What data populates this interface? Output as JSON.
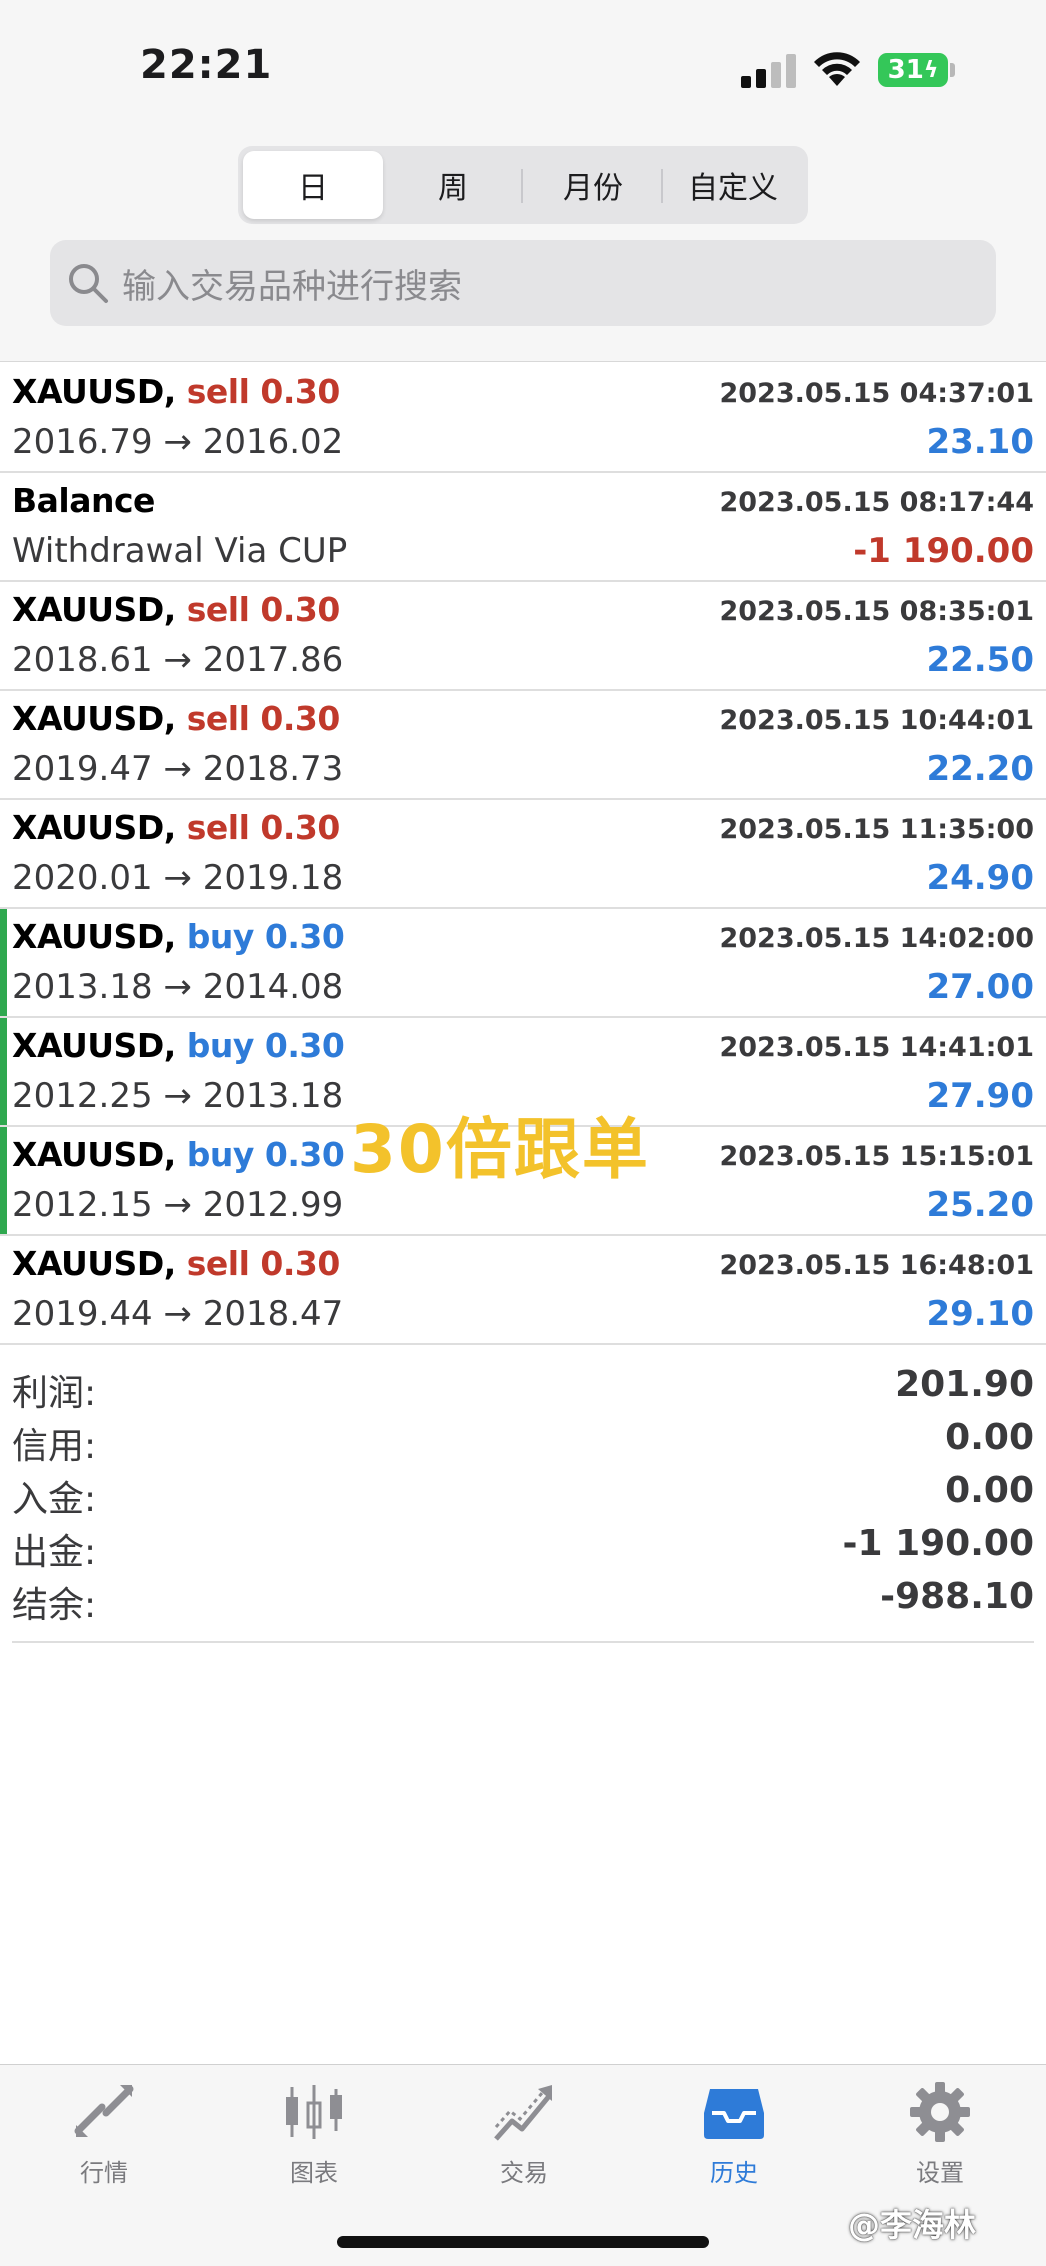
{
  "status": {
    "time": "22:21",
    "battery": "31"
  },
  "segments": [
    {
      "label": "日",
      "active": true
    },
    {
      "label": "周",
      "active": false
    },
    {
      "label": "月份",
      "active": false
    },
    {
      "label": "自定义",
      "active": false
    }
  ],
  "search": {
    "placeholder": "输入交易品种进行搜索"
  },
  "deals": [
    {
      "symbol": "XAUUSD,",
      "type": "sell 0.30",
      "side": "sell",
      "time": "2023.05.15 04:37:01",
      "prices": "2016.79 → 2016.02",
      "profit": "23.10"
    },
    {
      "symbol": "Balance",
      "type": "",
      "side": "balance",
      "time": "2023.05.15 08:17:44",
      "prices": "Withdrawal Via CUP",
      "profit": "-1 190.00"
    },
    {
      "symbol": "XAUUSD,",
      "type": "sell 0.30",
      "side": "sell",
      "time": "2023.05.15 08:35:01",
      "prices": "2018.61 → 2017.86",
      "profit": "22.50"
    },
    {
      "symbol": "XAUUSD,",
      "type": "sell 0.30",
      "side": "sell",
      "time": "2023.05.15 10:44:01",
      "prices": "2019.47 → 2018.73",
      "profit": "22.20"
    },
    {
      "symbol": "XAUUSD,",
      "type": "sell 0.30",
      "side": "sell",
      "time": "2023.05.15 11:35:00",
      "prices": "2020.01 → 2019.18",
      "profit": "24.90"
    },
    {
      "symbol": "XAUUSD,",
      "type": "buy 0.30",
      "side": "buy",
      "time": "2023.05.15 14:02:00",
      "prices": "2013.18 → 2014.08",
      "profit": "27.00"
    },
    {
      "symbol": "XAUUSD,",
      "type": "buy 0.30",
      "side": "buy",
      "time": "2023.05.15 14:41:01",
      "prices": "2012.25 → 2013.18",
      "profit": "27.90"
    },
    {
      "symbol": "XAUUSD,",
      "type": "buy 0.30",
      "side": "buy",
      "time": "2023.05.15 15:15:01",
      "prices": "2012.15 → 2012.99",
      "profit": "25.20"
    },
    {
      "symbol": "XAUUSD,",
      "type": "sell 0.30",
      "side": "sell",
      "time": "2023.05.15 16:48:01",
      "prices": "2019.44 → 2018.47",
      "profit": "29.10"
    }
  ],
  "overlay_text": "30倍跟单",
  "summary": [
    {
      "label": "利润:",
      "value": "201.90"
    },
    {
      "label": "信用:",
      "value": "0.00"
    },
    {
      "label": "入金:",
      "value": "0.00"
    },
    {
      "label": "出金:",
      "value": "-1 190.00"
    },
    {
      "label": "结余:",
      "value": "-988.10"
    }
  ],
  "tabs": [
    {
      "label": "行情",
      "icon": "quotes-icon",
      "active": false
    },
    {
      "label": "图表",
      "icon": "chart-icon",
      "active": false
    },
    {
      "label": "交易",
      "icon": "trade-icon",
      "active": false
    },
    {
      "label": "历史",
      "icon": "history-icon",
      "active": true
    },
    {
      "label": "设置",
      "icon": "settings-icon",
      "active": false
    }
  ],
  "credit": "@李海林",
  "colors": {
    "sell": "#c0392b",
    "buy": "#2e7bd8",
    "buy_marker": "#2fa84f",
    "active_tab": "#2e7bd8",
    "watermark": "#f3c22b"
  }
}
